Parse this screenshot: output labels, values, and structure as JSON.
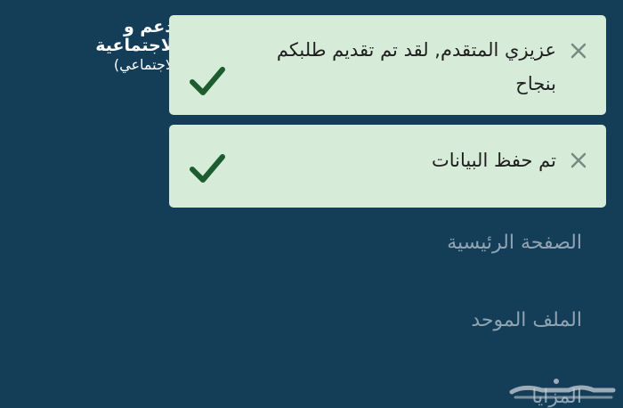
{
  "header": {
    "line1": "دعم و",
    "line2": "لاجتماعية",
    "line3": "لاجتماعي)"
  },
  "toasts": [
    {
      "message": "عزيزي المتقدم, لقد تم تقديم طلبكم بنجاح",
      "icon": "checkmark-icon",
      "close_icon": "close-icon"
    },
    {
      "message": "تم حفظ البيانات",
      "icon": "checkmark-icon",
      "close_icon": "close-icon"
    }
  ],
  "nav": {
    "items": [
      {
        "label": "الصفحة الرئيسية"
      },
      {
        "label": "الملف الموحد"
      },
      {
        "label": "المزايا"
      }
    ]
  },
  "watermark": {
    "text": "حراج"
  },
  "colors": {
    "background": "#143e58",
    "toast_bg": "#d6ecd9",
    "check": "#1c5c2e",
    "close": "#7a8a80",
    "nav_text": "#8fa3b2"
  }
}
